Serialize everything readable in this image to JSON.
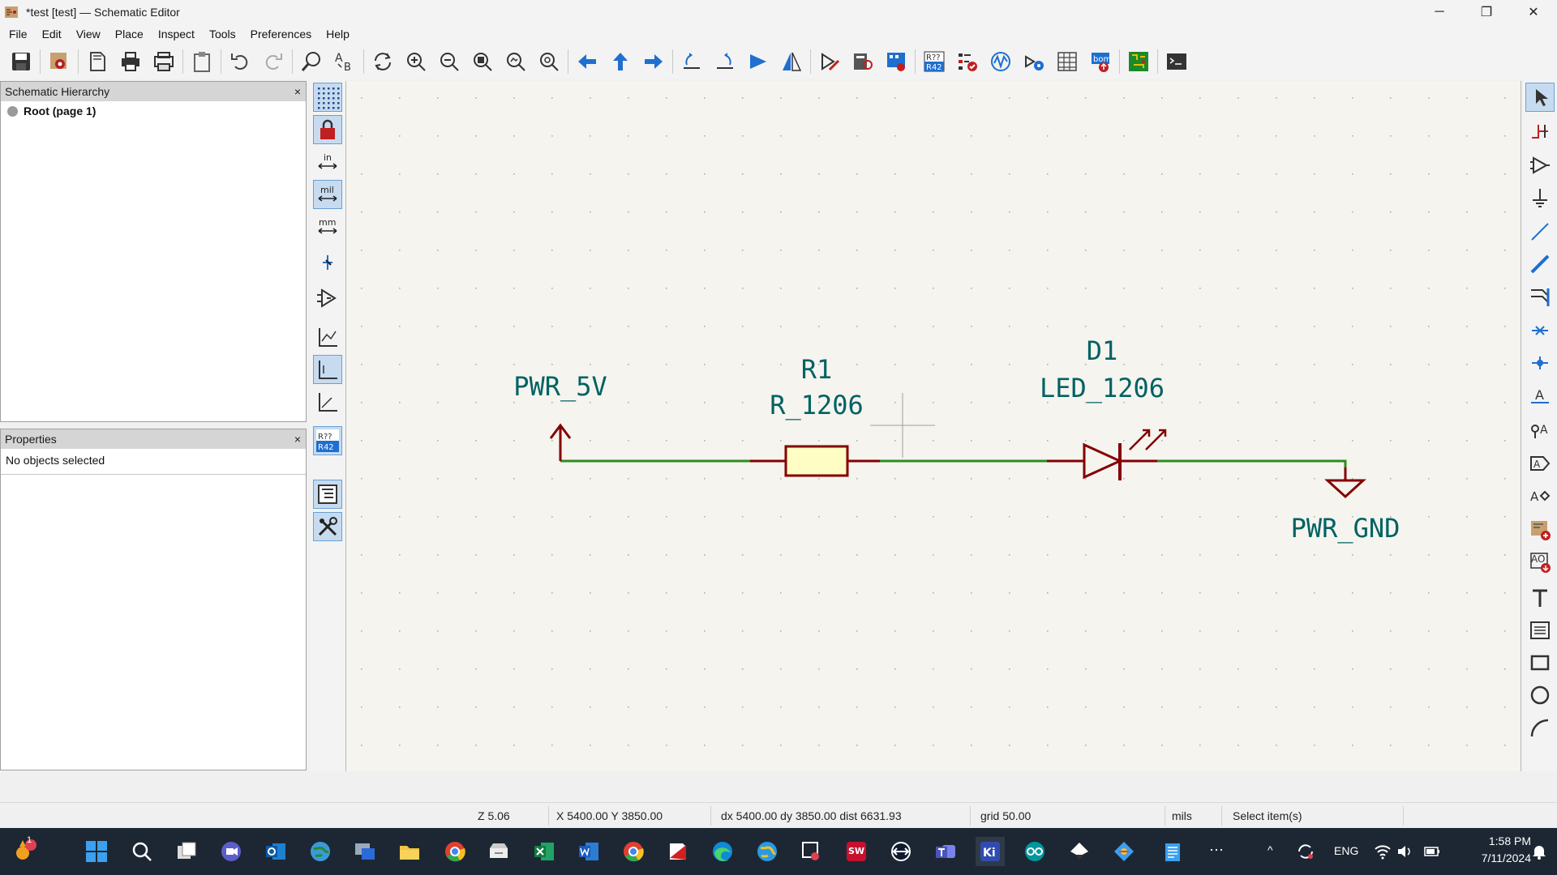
{
  "window": {
    "title": "*test [test] — Schematic Editor",
    "minimize": "─",
    "maximize": "❐",
    "close": "✕"
  },
  "menu": [
    "File",
    "Edit",
    "View",
    "Place",
    "Inspect",
    "Tools",
    "Preferences",
    "Help"
  ],
  "hierarchy_panel": {
    "title": "Schematic Hierarchy",
    "close": "×",
    "items": [
      {
        "label": "Root (page 1)"
      }
    ]
  },
  "properties_panel": {
    "title": "Properties",
    "close": "×",
    "empty_text": "No objects selected"
  },
  "schematic": {
    "power_5v": "PWR_5V",
    "r1_ref": "R1",
    "r1_value": "R_1206",
    "d1_ref": "D1",
    "d1_value": "LED_1206",
    "gnd": "PWR_GND",
    "colors": {
      "wire": "#2e8b1f",
      "symbol": "#840000",
      "body_fill": "#fdfdc4",
      "text": "#006262",
      "grid": "#b0b0b0"
    }
  },
  "status": {
    "zoom": "Z 5.06",
    "xy": "X 5400.00  Y 3850.00",
    "delta": "dx 5400.00  dy 3850.00  dist 6631.93",
    "grid": "grid 50.00",
    "units": "mils",
    "mode": "Select item(s)"
  },
  "taskbar": {
    "lang": "ENG",
    "time": "1:58 PM",
    "date": "7/11/2024",
    "notification_count": "1",
    "more": "⋯",
    "tray_up": "^"
  },
  "toolbar_icons": [
    "save-icon",
    "schematic-setup-icon",
    "page-settings-icon",
    "print-icon",
    "plot-icon",
    "paste-icon",
    "undo-icon",
    "redo-icon",
    "find-icon",
    "find-replace-icon",
    "refresh-icon",
    "zoom-in-icon",
    "zoom-out-icon",
    "zoom-fit-icon",
    "zoom-objects-icon",
    "zoom-selection-icon",
    "navigate-back-icon",
    "navigate-up-icon",
    "navigate-forward-icon",
    "rotate-ccw-icon",
    "rotate-cw-icon",
    "mirror-vertical-icon",
    "mirror-horizontal-icon",
    "symbol-editor-icon",
    "symbol-browser-icon",
    "footprint-assign-icon",
    "annotate-icon",
    "erc-icon",
    "simulator-icon",
    "bus-aliases-icon",
    "field-table-icon",
    "bom-icon",
    "pcb-editor-icon",
    "scripting-console-icon"
  ]
}
